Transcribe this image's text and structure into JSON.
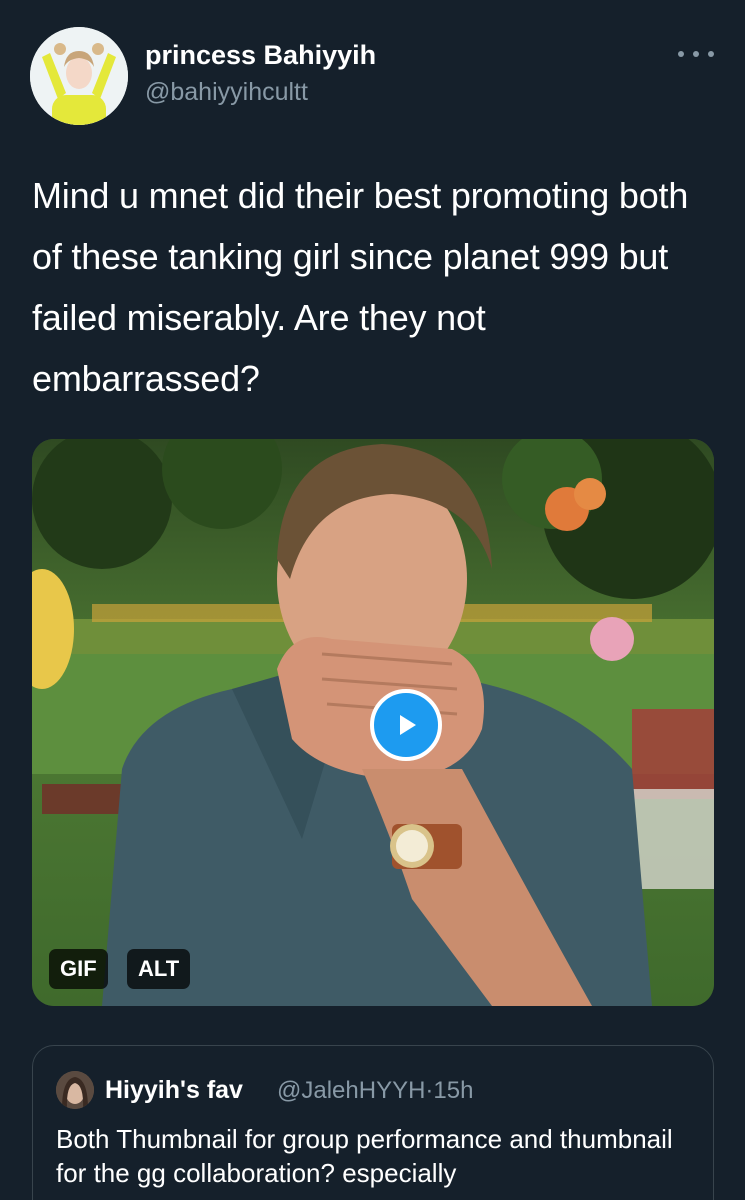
{
  "tweet": {
    "author": {
      "display_name": "princess Bahiyyih",
      "handle": "@bahiyyihcultt"
    },
    "text": "Mind u mnet did their best promoting both of these tanking girl since planet 999 but failed miserably. Are they not embarrassed?",
    "media": {
      "gif_badge": "GIF",
      "alt_badge": "ALT"
    },
    "more_icon": "more-options-icon"
  },
  "quoted_tweet": {
    "author_name": "Hiyyih's fav",
    "handle": "@JalehHYYH",
    "separator": "·",
    "time": "15h",
    "text": "Both Thumbnail for group performance and thumbnail for the gg collaboration? especially"
  },
  "colors": {
    "background": "#15202b",
    "secondary_text": "#8899a6",
    "accent": "#1d9bf0",
    "border": "#38444d"
  }
}
